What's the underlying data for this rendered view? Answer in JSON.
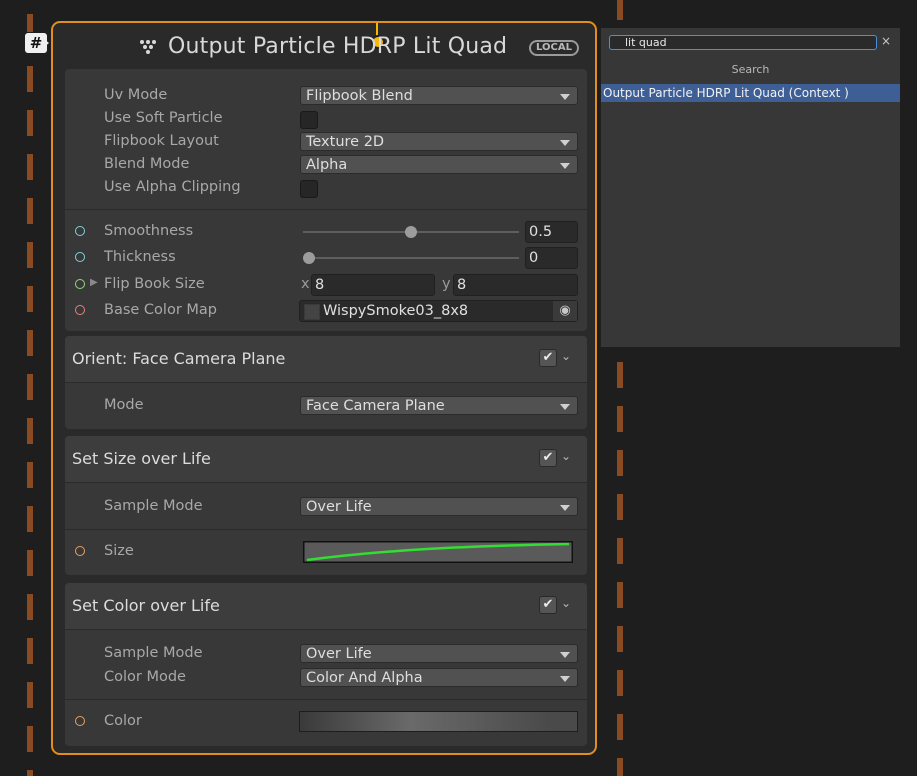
{
  "context": {
    "badge": "#",
    "title": "Output Particle HDRP Lit Quad",
    "space_badge": "LOCAL",
    "settings": {
      "uv_mode": {
        "label": "Uv Mode",
        "value": "Flipbook Blend"
      },
      "use_soft_particle": {
        "label": "Use Soft Particle",
        "checked": false
      },
      "flipbook_layout": {
        "label": "Flipbook Layout",
        "value": "Texture 2D"
      },
      "blend_mode": {
        "label": "Blend Mode",
        "value": "Alpha"
      },
      "use_alpha_clipping": {
        "label": "Use Alpha Clipping",
        "checked": false
      }
    },
    "properties": {
      "smoothness": {
        "label": "Smoothness",
        "value": "0.5",
        "fraction": 0.5
      },
      "thickness": {
        "label": "Thickness",
        "value": "0",
        "fraction": 0
      },
      "flip_book_size": {
        "label": "Flip Book Size",
        "x_axis": "x",
        "x": "8",
        "y_axis": "y",
        "y": "8"
      },
      "base_color_map": {
        "label": "Base Color Map",
        "value": "WispySmoke03_8x8"
      }
    }
  },
  "blocks": {
    "orient": {
      "title": "Orient: Face Camera Plane",
      "enabled": true,
      "mode_label": "Mode",
      "mode_value": "Face Camera Plane"
    },
    "size_over_life": {
      "title": "Set Size over Life",
      "enabled": true,
      "sample_mode_label": "Sample Mode",
      "sample_mode_value": "Over Life",
      "size_label": "Size"
    },
    "color_over_life": {
      "title": "Set Color over Life",
      "enabled": true,
      "sample_mode_label": "Sample Mode",
      "sample_mode_value": "Over Life",
      "color_mode_label": "Color Mode",
      "color_mode_value": "Color And Alpha",
      "color_label": "Color"
    }
  },
  "search": {
    "query": "lit quad",
    "heading": "Search",
    "clear": "×",
    "results": [
      "Output Particle HDRP Lit Quad (Context )"
    ]
  },
  "colors": {
    "context_border": "#e08f1f",
    "flow_port": "#f5b700",
    "port_float": "#7fd0d8",
    "port_vector2": "#8fd87a",
    "port_texture": "#e88080",
    "port_curve": "#e8a060",
    "curve": "#33dd33",
    "selection": "#3e5f96"
  },
  "icons": {
    "check": "✔",
    "chevron": "⌄",
    "expand": "▶",
    "picker": "◉"
  }
}
